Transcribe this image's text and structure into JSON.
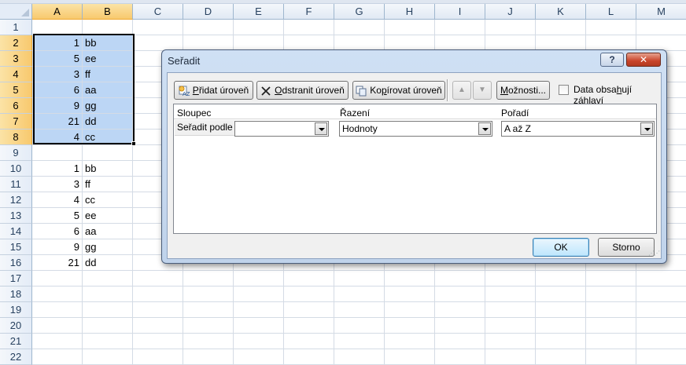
{
  "columns": [
    "A",
    "B",
    "C",
    "D",
    "E",
    "F",
    "G",
    "H",
    "I",
    "J",
    "K",
    "L",
    "M"
  ],
  "rows": [
    {
      "n": "1",
      "a": "",
      "b": ""
    },
    {
      "n": "2",
      "a": "1",
      "b": "bb"
    },
    {
      "n": "3",
      "a": "5",
      "b": "ee"
    },
    {
      "n": "4",
      "a": "3",
      "b": "ff"
    },
    {
      "n": "5",
      "a": "6",
      "b": "aa"
    },
    {
      "n": "6",
      "a": "9",
      "b": "gg"
    },
    {
      "n": "7",
      "a": "21",
      "b": "dd"
    },
    {
      "n": "8",
      "a": "4",
      "b": "cc"
    },
    {
      "n": "9",
      "a": "",
      "b": ""
    },
    {
      "n": "10",
      "a": "1",
      "b": "bb"
    },
    {
      "n": "11",
      "a": "3",
      "b": "ff"
    },
    {
      "n": "12",
      "a": "4",
      "b": "cc"
    },
    {
      "n": "13",
      "a": "5",
      "b": "ee"
    },
    {
      "n": "14",
      "a": "6",
      "b": "aa"
    },
    {
      "n": "15",
      "a": "9",
      "b": "gg"
    },
    {
      "n": "16",
      "a": "21",
      "b": "dd"
    },
    {
      "n": "17",
      "a": "",
      "b": ""
    },
    {
      "n": "18",
      "a": "",
      "b": ""
    },
    {
      "n": "19",
      "a": "",
      "b": ""
    },
    {
      "n": "20",
      "a": "",
      "b": ""
    },
    {
      "n": "21",
      "a": "",
      "b": ""
    },
    {
      "n": "22",
      "a": "",
      "b": ""
    }
  ],
  "selection": {
    "columns": [
      "A",
      "B"
    ],
    "rows": [
      "2",
      "3",
      "4",
      "5",
      "6",
      "7",
      "8"
    ]
  },
  "dialog": {
    "title": "Seřadit",
    "help_label": "?",
    "close_label": "✕",
    "add_level": {
      "prefix": "P",
      "rest": "řidat úroveň"
    },
    "delete_level": {
      "prefix": "O",
      "rest": "dstranit úroveň"
    },
    "copy_level": {
      "before": "Ko",
      "key": "p",
      "rest": "írovat úroveň"
    },
    "move_up_label": "▲",
    "move_down_label": "▼",
    "options": {
      "key": "M",
      "rest": "ožnosti..."
    },
    "header_checkbox": {
      "before": "Data obsa",
      "key": "h",
      "rest": "ují záhlaví",
      "checked": false
    },
    "grid": {
      "col_column": "Sloupec",
      "col_sort_on": "Řazení",
      "col_order": "Pořadí",
      "row_label": "Seřadit podle",
      "column_value": "",
      "sort_on_value": "Hodnoty",
      "order_value": "A až Z"
    },
    "ok_label": "OK",
    "cancel_label": "Storno"
  },
  "colors": {
    "selection": "#bcd6f5",
    "header_selected": "#f8c96e"
  }
}
